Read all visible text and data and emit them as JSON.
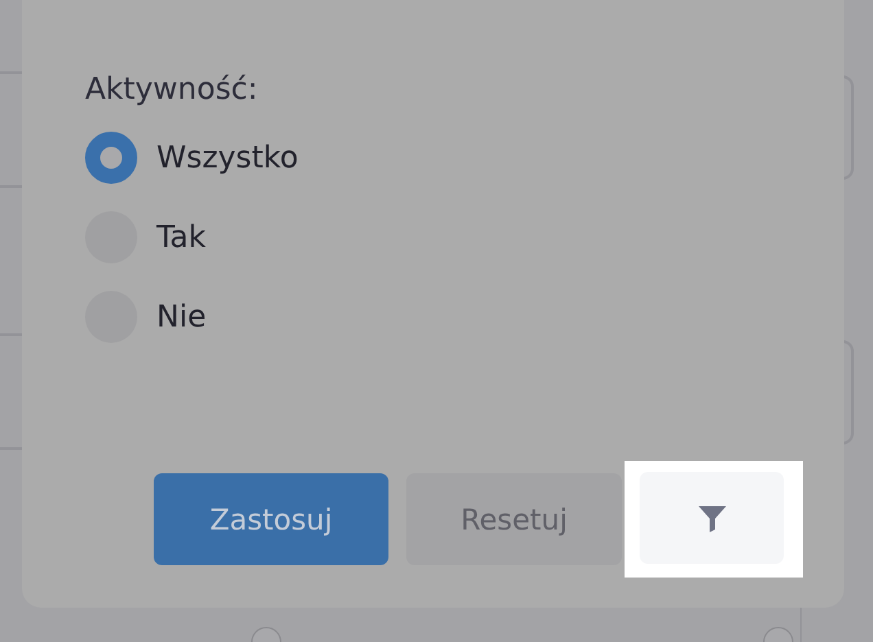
{
  "filter_panel": {
    "heading": "Aktywność:",
    "options": [
      {
        "label": "Wszystko",
        "selected": true
      },
      {
        "label": "Tak",
        "selected": false
      },
      {
        "label": "Nie",
        "selected": false
      }
    ],
    "buttons": [
      {
        "kind": "primary",
        "label": "Zastosuj"
      },
      {
        "kind": "secondary",
        "label": "Resetuj"
      },
      {
        "kind": "icon",
        "focused": true
      }
    ]
  }
}
